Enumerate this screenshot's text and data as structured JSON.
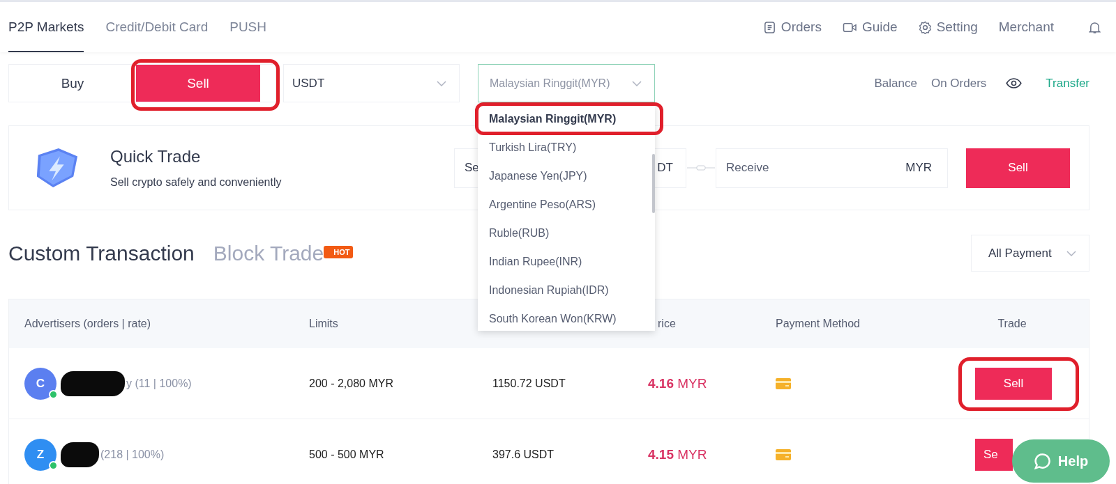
{
  "nav": {
    "tabs": [
      {
        "label": "P2P Markets",
        "selected": true
      },
      {
        "label": "Credit/Debit Card",
        "selected": false
      },
      {
        "label": "PUSH",
        "selected": false
      }
    ],
    "links": [
      "Orders",
      "Guide",
      "Setting",
      "Merchant"
    ]
  },
  "side_toggle": [
    {
      "label": "Buy",
      "selected": false,
      "highlighted": false
    },
    {
      "label": "Sell",
      "selected": true,
      "highlighted": true
    }
  ],
  "crypto_select": {
    "value": "USDT"
  },
  "fiat_select": {
    "value": "Malaysian Ringgit(MYR)",
    "expanded": true
  },
  "fiat_options": [
    {
      "label": "Malaysian Ringgit(MYR)",
      "selected": true,
      "highlighted": true
    },
    {
      "label": "Turkish Lira(TRY)",
      "selected": false,
      "highlighted": false
    },
    {
      "label": "Japanese Yen(JPY)",
      "selected": false,
      "highlighted": false
    },
    {
      "label": "Argentine Peso(ARS)",
      "selected": false,
      "highlighted": false
    },
    {
      "label": "Ruble(RUB)",
      "selected": false,
      "highlighted": false
    },
    {
      "label": "Indian Rupee(INR)",
      "selected": false,
      "highlighted": false
    },
    {
      "label": "Indonesian Rupiah(IDR)",
      "selected": false,
      "highlighted": false
    },
    {
      "label": "South Korean Won(KRW)",
      "selected": false,
      "highlighted": false
    }
  ],
  "wallet": {
    "balance": "Balance",
    "on_orders": "On Orders",
    "transfer": "Transfer"
  },
  "quick_trade": {
    "title": "Quick Trade",
    "subtitle": "Sell crypto safely and conveniently",
    "spend_label": "Se",
    "spend_currency": "DT",
    "receive_placeholder": "Receive",
    "receive_currency": "MYR",
    "button": "Sell"
  },
  "section_tabs": [
    {
      "label": "Custom Transaction",
      "selected": true
    },
    {
      "label": "Block Trade",
      "selected": false,
      "badge": "HOT"
    }
  ],
  "payment_filter": {
    "value": "All Payment"
  },
  "table": {
    "columns": [
      "Advertisers (orders | rate)",
      "Limits",
      "rice",
      "Payment Method",
      "Trade"
    ],
    "rows": [
      {
        "avatar": "C",
        "color": "#5b7ff0",
        "online": true,
        "stats": "y (11 | 100%)",
        "limits": "200 -  2,080 MYR",
        "available": "1150.72 USDT",
        "price": "4.16",
        "price_unit": "MYR",
        "action": "Sell",
        "highlighted": true
      },
      {
        "avatar": "Z",
        "color": "#2f8ef2",
        "online": true,
        "stats": "(218 | 100%)",
        "limits": "500 -  500 MYR",
        "available": "397.6 USDT",
        "price": "4.15",
        "price_unit": "MYR",
        "action": "Se",
        "highlighted": false
      }
    ]
  },
  "help_button": {
    "label": "Help"
  }
}
